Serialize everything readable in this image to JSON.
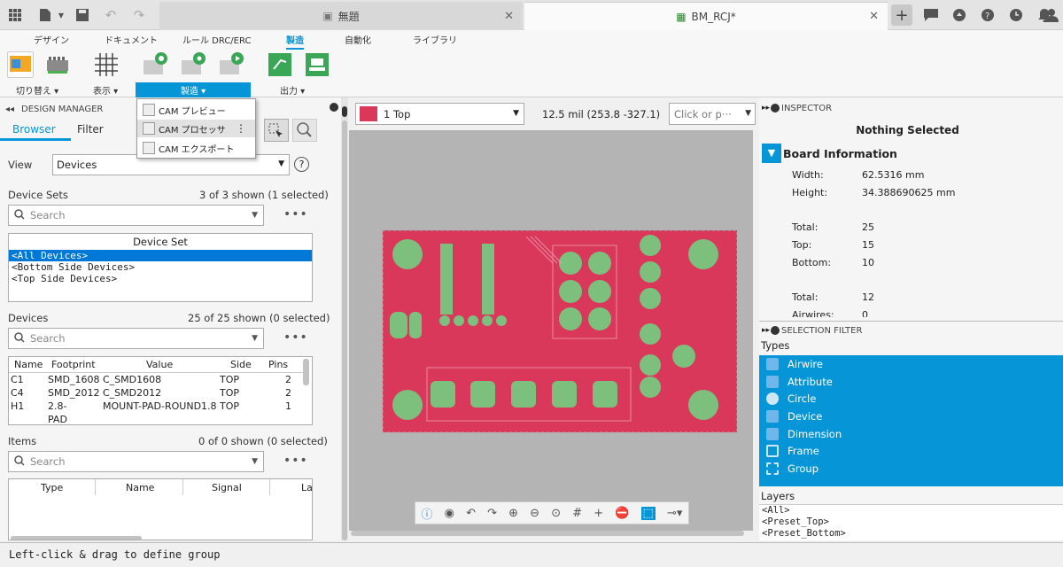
{
  "tabs": [
    {
      "label": "無題"
    },
    {
      "label": "BM_RCJ*"
    }
  ],
  "ribbon": {
    "tabs": [
      "デザイン",
      "ドキュメント",
      "ルール DRC/ERC",
      "製造",
      "自動化",
      "ライブラリ"
    ],
    "groups": {
      "switch": "切り替え ▾",
      "view": "表示 ▾",
      "mfg": "製造 ▾",
      "output": "出力 ▾"
    }
  },
  "mfg_menu": {
    "items": [
      "CAM プレビュー",
      "CAM プロセッサ",
      "CAM エクスポート"
    ],
    "more": "⋮"
  },
  "design_manager": {
    "title": "DESIGN MANAGER",
    "tabs": [
      "Browser",
      "Filter"
    ],
    "view_label": "View",
    "view_value": "Devices",
    "help": "?",
    "device_sets_label": "Device Sets",
    "device_sets_count": "3 of 3 shown (1 selected)",
    "search_placeholder": "Search",
    "more": "•••",
    "device_set_header": "Device Set",
    "device_sets": [
      "<All Devices>",
      "<Bottom Side Devices>",
      "<Top Side Devices>"
    ],
    "devices_label": "Devices",
    "devices_count": "25 of 25 shown (0 selected)",
    "device_cols": [
      "Name",
      "Footprint",
      "Value",
      "Side",
      "Pins"
    ],
    "devices": [
      [
        "C1",
        "SMD_1608",
        "C_SMD1608",
        "TOP",
        "2"
      ],
      [
        "C4",
        "SMD_2012",
        "C_SMD2012",
        "TOP",
        "2"
      ],
      [
        "H1",
        "2.8-PAD",
        "MOUNT-PAD-ROUND1.8",
        "TOP",
        "1"
      ]
    ],
    "items_label": "Items",
    "items_count": "0 of 0 shown (0 selected)",
    "item_cols": [
      "Type",
      "Name",
      "Signal",
      "La"
    ]
  },
  "canvas_toolbar": {
    "layer": "1 Top",
    "layer_color": "#d9385a",
    "coords": "12.5 mil (253.8 -327.1)",
    "cmd_placeholder": "Click or p···"
  },
  "inspector": {
    "title": "INSPECTOR",
    "selected": "Nothing Selected",
    "section": "Board Information",
    "props": [
      {
        "k": "Width:",
        "v": "62.5316 mm"
      },
      {
        "k": "Height:",
        "v": "34.388690625 mm"
      },
      {
        "k": "Total:",
        "v": "25"
      },
      {
        "k": "Top:",
        "v": "15"
      },
      {
        "k": "Bottom:",
        "v": "10"
      },
      {
        "k": "Total:",
        "v": "12"
      },
      {
        "k": "Airwires:",
        "v": "0"
      }
    ]
  },
  "selection_filter": {
    "title": "SELECTION FILTER",
    "types_label": "Types",
    "types": [
      "Airwire",
      "Attribute",
      "Circle",
      "Device",
      "Dimension",
      "Frame",
      "Group"
    ],
    "layers_label": "Layers",
    "layers": [
      "<All>",
      "<Preset_Top>",
      "<Preset_Bottom>"
    ]
  },
  "status": "Left-click & drag to define group",
  "colors": {
    "accent": "#0696d7",
    "board": "#d9385a",
    "pad": "#7dbf7d"
  }
}
